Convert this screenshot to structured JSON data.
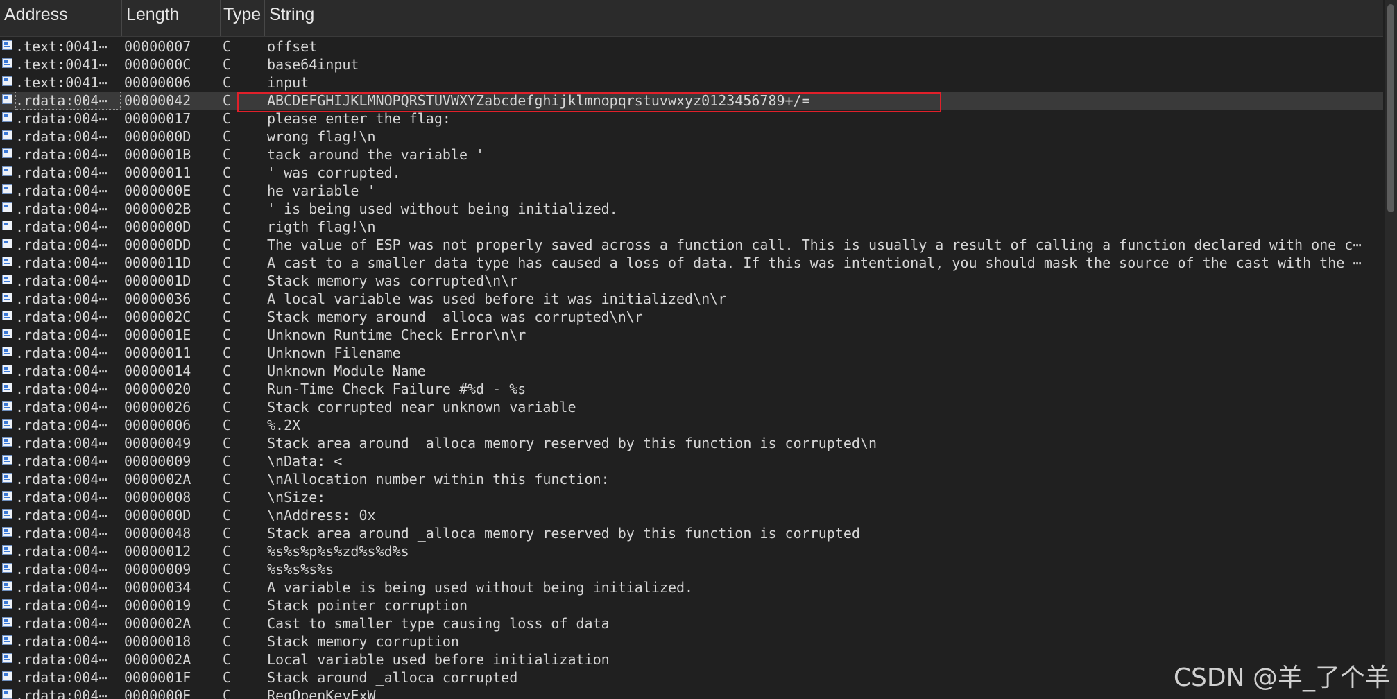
{
  "columns": {
    "address": "Address",
    "length": "Length",
    "type": "Type",
    "string": "String"
  },
  "rows": [
    {
      "address": ".text:0041⋯",
      "length": "00000007",
      "type": "C",
      "string": "offset"
    },
    {
      "address": ".text:0041⋯",
      "length": "0000000C",
      "type": "C",
      "string": "base64input"
    },
    {
      "address": ".text:0041⋯",
      "length": "00000006",
      "type": "C",
      "string": "input"
    },
    {
      "address": ".rdata:004⋯",
      "length": "00000042",
      "type": "C",
      "string": "ABCDEFGHIJKLMNOPQRSTUVWXYZabcdefghijklmnopqrstuvwxyz0123456789+/="
    },
    {
      "address": ".rdata:004⋯",
      "length": "00000017",
      "type": "C",
      "string": "please enter the flag:"
    },
    {
      "address": ".rdata:004⋯",
      "length": "0000000D",
      "type": "C",
      "string": "wrong flag!\\n"
    },
    {
      "address": ".rdata:004⋯",
      "length": "0000001B",
      "type": "C",
      "string": "tack around the variable '"
    },
    {
      "address": ".rdata:004⋯",
      "length": "00000011",
      "type": "C",
      "string": "' was corrupted."
    },
    {
      "address": ".rdata:004⋯",
      "length": "0000000E",
      "type": "C",
      "string": "he variable '"
    },
    {
      "address": ".rdata:004⋯",
      "length": "0000002B",
      "type": "C",
      "string": "' is being used without being initialized."
    },
    {
      "address": ".rdata:004⋯",
      "length": "0000000D",
      "type": "C",
      "string": "rigth flag!\\n"
    },
    {
      "address": ".rdata:004⋯",
      "length": "000000DD",
      "type": "C",
      "string": "The value of ESP was not properly saved across a function call.  This is usually a result of calling a function declared with one c⋯"
    },
    {
      "address": ".rdata:004⋯",
      "length": "0000011D",
      "type": "C",
      "string": "A cast to a smaller data type has caused a loss of data.  If this was intentional, you should mask the source of the cast with the ⋯"
    },
    {
      "address": ".rdata:004⋯",
      "length": "0000001D",
      "type": "C",
      "string": "Stack memory was corrupted\\n\\r"
    },
    {
      "address": ".rdata:004⋯",
      "length": "00000036",
      "type": "C",
      "string": "A local variable was used before it was initialized\\n\\r"
    },
    {
      "address": ".rdata:004⋯",
      "length": "0000002C",
      "type": "C",
      "string": "Stack memory around _alloca was corrupted\\n\\r"
    },
    {
      "address": ".rdata:004⋯",
      "length": "0000001E",
      "type": "C",
      "string": "Unknown Runtime Check Error\\n\\r"
    },
    {
      "address": ".rdata:004⋯",
      "length": "00000011",
      "type": "C",
      "string": "Unknown Filename"
    },
    {
      "address": ".rdata:004⋯",
      "length": "00000014",
      "type": "C",
      "string": "Unknown Module Name"
    },
    {
      "address": ".rdata:004⋯",
      "length": "00000020",
      "type": "C",
      "string": "Run-Time Check Failure #%d - %s"
    },
    {
      "address": ".rdata:004⋯",
      "length": "00000026",
      "type": "C",
      "string": "Stack corrupted near unknown variable"
    },
    {
      "address": ".rdata:004⋯",
      "length": "00000006",
      "type": "C",
      "string": "%.2X"
    },
    {
      "address": ".rdata:004⋯",
      "length": "00000049",
      "type": "C",
      "string": "Stack area around _alloca memory reserved by this function is corrupted\\n"
    },
    {
      "address": ".rdata:004⋯",
      "length": "00000009",
      "type": "C",
      "string": "\\nData: <"
    },
    {
      "address": ".rdata:004⋯",
      "length": "0000002A",
      "type": "C",
      "string": "\\nAllocation number within this function:"
    },
    {
      "address": ".rdata:004⋯",
      "length": "00000008",
      "type": "C",
      "string": "\\nSize:"
    },
    {
      "address": ".rdata:004⋯",
      "length": "0000000D",
      "type": "C",
      "string": "\\nAddress: 0x"
    },
    {
      "address": ".rdata:004⋯",
      "length": "00000048",
      "type": "C",
      "string": "Stack area around _alloca memory reserved by this function is corrupted"
    },
    {
      "address": ".rdata:004⋯",
      "length": "00000012",
      "type": "C",
      "string": "%s%s%p%s%zd%s%d%s"
    },
    {
      "address": ".rdata:004⋯",
      "length": "00000009",
      "type": "C",
      "string": "%s%s%s%s"
    },
    {
      "address": ".rdata:004⋯",
      "length": "00000034",
      "type": "C",
      "string": "A variable is being used without being initialized."
    },
    {
      "address": ".rdata:004⋯",
      "length": "00000019",
      "type": "C",
      "string": "Stack pointer corruption"
    },
    {
      "address": ".rdata:004⋯",
      "length": "0000002A",
      "type": "C",
      "string": "Cast to smaller type causing loss of data"
    },
    {
      "address": ".rdata:004⋯",
      "length": "00000018",
      "type": "C",
      "string": "Stack memory corruption"
    },
    {
      "address": ".rdata:004⋯",
      "length": "0000002A",
      "type": "C",
      "string": "Local variable used before initialization"
    },
    {
      "address": ".rdata:004⋯",
      "length": "0000001F",
      "type": "C",
      "string": "Stack around _alloca corrupted"
    },
    {
      "address": ".rdata:004⋯",
      "length": "0000000E",
      "type": "C",
      "string": "RegOpenKeyExW"
    }
  ],
  "selected_row": 3,
  "highlight_color": "#e0202a",
  "watermark": "CSDN @羊_了个羊"
}
